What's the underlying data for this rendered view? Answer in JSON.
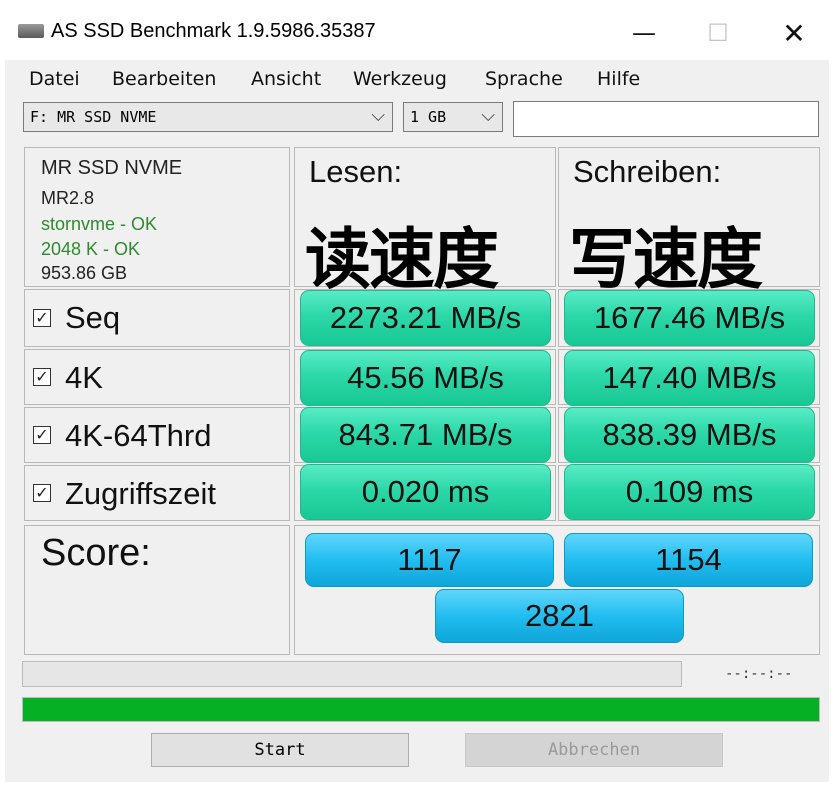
{
  "window": {
    "title": "AS SSD Benchmark 1.9.5986.35387",
    "minimize_glyph": "—",
    "maximize_glyph": "☐",
    "close_glyph": "✕"
  },
  "menu": {
    "items": [
      "Datei",
      "Bearbeiten",
      "Ansicht",
      "Werkzeug",
      "Sprache",
      "Hilfe"
    ]
  },
  "drive_select": {
    "value": "F: MR SSD  NVME"
  },
  "size_select": {
    "value": "1 GB"
  },
  "icons": {
    "app": "drive-icon",
    "dropdown": "chevron-down-icon"
  },
  "drive_info": {
    "name": "MR SSD  NVME",
    "firmware": "MR2.8",
    "driver": "stornvme - OK",
    "alignment": "2048 K - OK",
    "capacity": "953.86 GB"
  },
  "headers": {
    "read": "Lesen:",
    "write": "Schreiben:",
    "read_cn": "读速度",
    "write_cn": "写速度"
  },
  "rows": [
    {
      "label": "Seq",
      "checked": true,
      "read": "2273.21 MB/s",
      "write": "1677.46 MB/s"
    },
    {
      "label": "4K",
      "checked": true,
      "read": "45.56 MB/s",
      "write": "147.40 MB/s"
    },
    {
      "label": "4K-64Thrd",
      "checked": true,
      "read": "843.71 MB/s",
      "write": "838.39 MB/s"
    },
    {
      "label": "Zugriffszeit",
      "checked": true,
      "read": "0.020 ms",
      "write": "0.109 ms"
    }
  ],
  "checkbox_glyph": "✓",
  "score": {
    "label": "Score:",
    "read": "1117",
    "write": "1154",
    "total": "2821"
  },
  "progress": {
    "time": "--:--:--",
    "test_fraction": 0,
    "total_fraction": 1.0
  },
  "colors": {
    "result_green": "#2dd8a8",
    "score_blue": "#22bdf0",
    "progress_green": "#06b025",
    "ok_text": "#2f8a2f"
  },
  "buttons": {
    "start": "Start",
    "abort": "Abbrechen"
  }
}
